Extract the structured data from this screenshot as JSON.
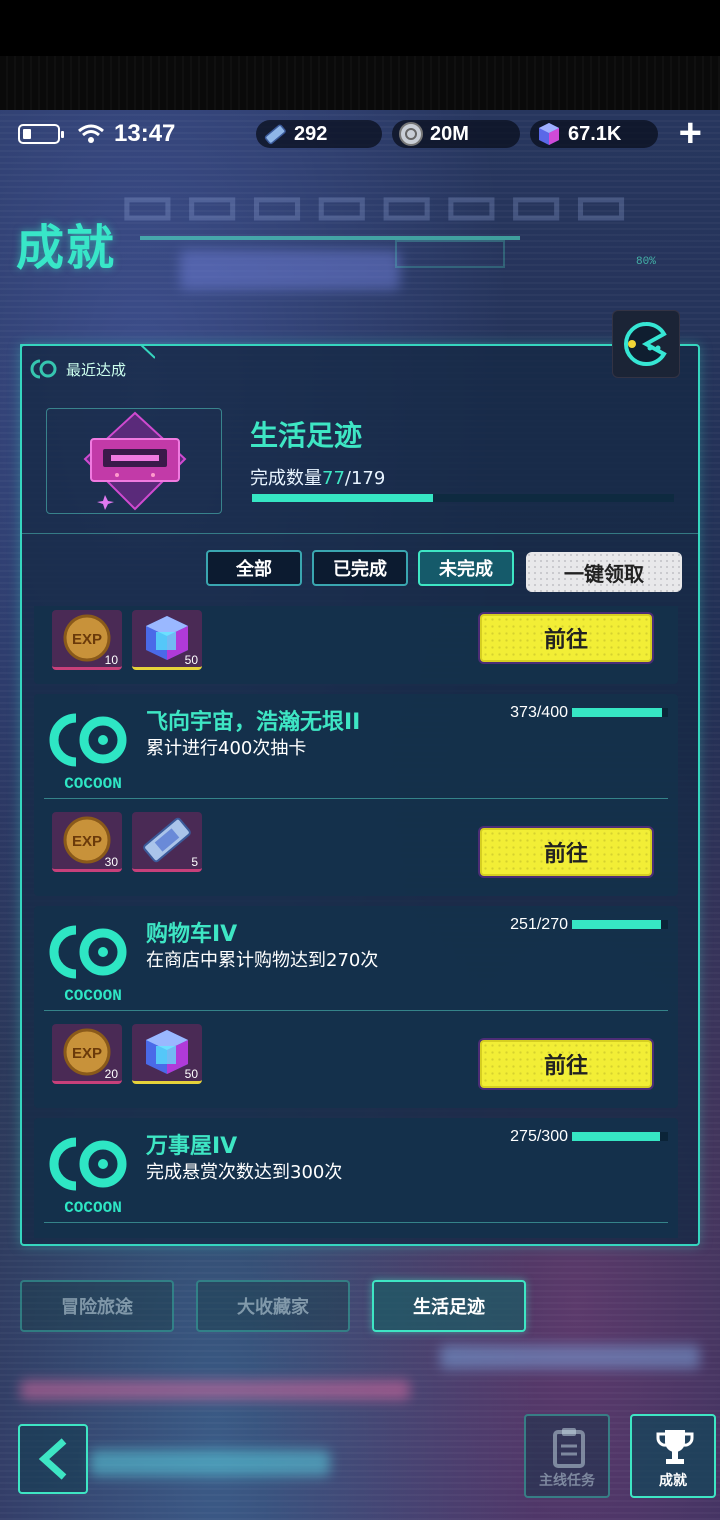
{
  "status": {
    "time": "13:47"
  },
  "currencies": [
    {
      "icon": "ticket-icon",
      "value": "292"
    },
    {
      "icon": "coin-icon",
      "value": "20M"
    },
    {
      "icon": "gem-icon",
      "value": "67.1K"
    }
  ],
  "header": {
    "title": "成就",
    "deco_pct": "80%"
  },
  "panel": {
    "label": "最近达成"
  },
  "recent": {
    "name": "生活足迹",
    "count_label": "完成数量",
    "current": "77",
    "total": "/179",
    "progress": 0.43
  },
  "filters": [
    {
      "label": "全部",
      "active": false
    },
    {
      "label": "已完成",
      "active": false
    },
    {
      "label": "未完成",
      "active": true
    }
  ],
  "claim_all": "一键领取",
  "achievements": [
    {
      "rewards": [
        {
          "type": "exp",
          "qty": "10"
        },
        {
          "type": "gem",
          "qty": "50"
        }
      ],
      "button": "前往"
    },
    {
      "name": "飞向宇宙，浩瀚无垠II",
      "desc": "累计进行400次抽卡",
      "progress_text": "373/400",
      "progress": 0.9325,
      "rewards": [
        {
          "type": "exp",
          "qty": "30"
        },
        {
          "type": "ticket",
          "qty": "5"
        }
      ],
      "button": "前往"
    },
    {
      "name": "购物车IV",
      "desc": "在商店中累计购物达到270次",
      "progress_text": "251/270",
      "progress": 0.93,
      "rewards": [
        {
          "type": "exp",
          "qty": "20"
        },
        {
          "type": "gem",
          "qty": "50"
        }
      ],
      "button": "前往"
    },
    {
      "name": "万事屋IV",
      "desc": "完成悬赏次数达到300次",
      "progress_text": "275/300",
      "progress": 0.9167
    }
  ],
  "logo_text": "COCOON",
  "categories": [
    {
      "label": "冒险旅途",
      "active": false
    },
    {
      "label": "大收藏家",
      "active": false
    },
    {
      "label": "生活足迹",
      "active": true
    }
  ],
  "nav": [
    {
      "label": "主线任务",
      "icon": "clipboard-icon",
      "active": false
    },
    {
      "label": "成就",
      "icon": "trophy-icon",
      "active": true
    }
  ]
}
